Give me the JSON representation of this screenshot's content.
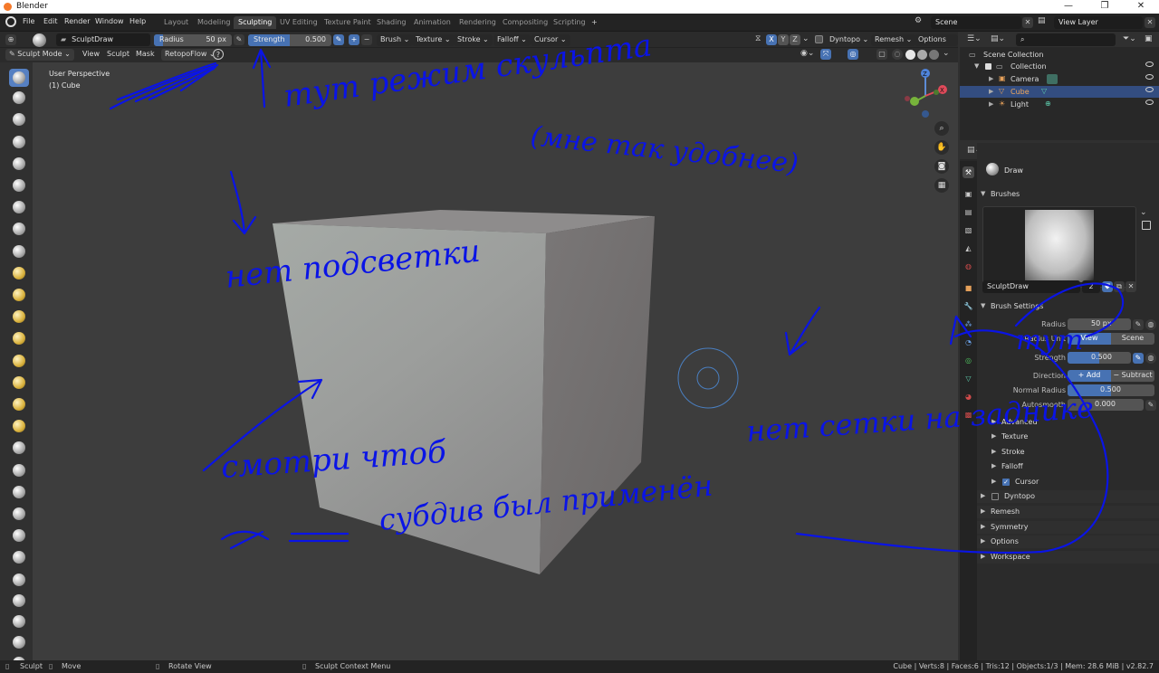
{
  "window": {
    "title": "Blender",
    "controls": [
      "—",
      "❐",
      "✕"
    ]
  },
  "menu": [
    "File",
    "Edit",
    "Render",
    "Window",
    "Help"
  ],
  "workspaces": [
    "Layout",
    "Modeling",
    "Sculpting",
    "UV Editing",
    "Texture Paint",
    "Shading",
    "Animation",
    "Rendering",
    "Compositing",
    "Scripting"
  ],
  "active_workspace": "Sculpting",
  "add_workspace": "+",
  "scene": {
    "label": "Scene"
  },
  "view_layer": {
    "label": "View Layer"
  },
  "tool_header": {
    "brush_name": "SculptDraw",
    "radius": {
      "label": "Radius",
      "value": "50 px"
    },
    "strength": {
      "label": "Strength",
      "value": "0.500",
      "fraction": 0.5
    },
    "add": "+",
    "sub": "−",
    "dropdowns": [
      "Brush",
      "Texture",
      "Stroke",
      "Falloff",
      "Cursor"
    ],
    "axes": [
      "X",
      "Y",
      "Z"
    ],
    "dyntopo": "Dyntopo",
    "remesh": "Remesh",
    "options": "Options"
  },
  "mode_header": {
    "mode": "Sculpt Mode",
    "menus": [
      "View",
      "Sculpt",
      "Mask"
    ],
    "addon": "RetopoFlow",
    "help_icon": "?"
  },
  "viewport": {
    "perspective": "User Perspective",
    "object": "(1) Cube",
    "gizmo_axes": [
      "X",
      "Y",
      "Z"
    ]
  },
  "outliner": {
    "root": "Scene Collection",
    "collection": "Collection",
    "items": [
      {
        "name": "Camera",
        "selected": false,
        "color": "#e6a15a"
      },
      {
        "name": "Cube",
        "selected": true,
        "color": "#e6a15a"
      },
      {
        "name": "Light",
        "selected": false,
        "color": "#e6a15a"
      }
    ]
  },
  "properties": {
    "tool_name": "Draw",
    "brushes_panel": "Brushes",
    "brush_field": "SculptDraw",
    "brush_users": "2",
    "brush_settings": "Brush Settings",
    "rows": {
      "radius": {
        "label": "Radius",
        "value": "50 px"
      },
      "radius_unit": {
        "label": "Radius Unit",
        "options": [
          "View",
          "Scene"
        ],
        "selected": "View"
      },
      "strength": {
        "label": "Strength",
        "value": "0.500",
        "fraction": 0.5
      },
      "direction": {
        "label": "Direction",
        "options": [
          "+ Add",
          "− Subtract"
        ],
        "selected": "+ Add"
      },
      "normal_radius": {
        "label": "Normal Radius",
        "value": "0.500",
        "fraction": 0.5
      },
      "autosmooth": {
        "label": "Autosmooth",
        "value": "0.000",
        "fraction": 0.0
      }
    },
    "subpanels": [
      "Advanced",
      "Texture",
      "Stroke",
      "Falloff",
      "Cursor"
    ],
    "cursor_checked": true,
    "panels": [
      "Dyntopo",
      "Remesh",
      "Symmetry",
      "Options",
      "Workspace"
    ]
  },
  "status": {
    "left": [
      {
        "label": "Sculpt"
      },
      {
        "label": "Move"
      },
      {
        "label": "Rotate View"
      },
      {
        "label": "Sculpt Context Menu"
      }
    ],
    "stats": "Cube | Verts:8 | Faces:6 | Tris:12 | Objects:1/3 | Mem: 28.6 MiB | v2.82.7"
  },
  "annotations": {
    "color": "#0a14e6",
    "texts": [
      "тут режим скульпта",
      "(мне так удобнее)",
      "нет подсветки",
      "тут",
      "нет сетки на заднике",
      "смотри чтоб",
      "субдив был применён"
    ]
  },
  "colors": {
    "accent": "#4772b3",
    "selection": "#334d80",
    "viewport_bg": "#3d3d3d",
    "panel_bg": "#2b2b2b"
  }
}
